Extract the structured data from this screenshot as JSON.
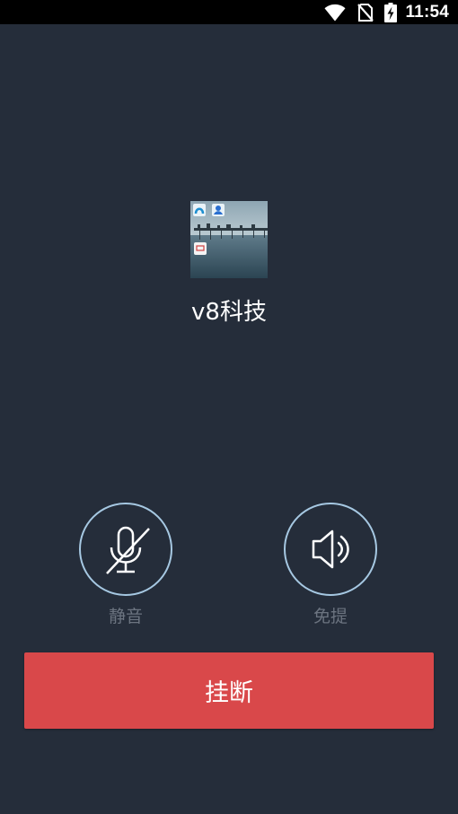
{
  "status_bar": {
    "time": "11:54",
    "icons": [
      "wifi-icon",
      "no-sim-icon",
      "battery-charging-icon"
    ]
  },
  "call": {
    "contact_name": "v8科技",
    "avatar": "pier-photo-avatar"
  },
  "controls": {
    "mute_label": "静音",
    "mute_icon": "microphone-off-icon",
    "speaker_label": "免提",
    "speaker_icon": "speaker-icon"
  },
  "hangup": {
    "label": "挂断"
  },
  "colors": {
    "background": "#252d3a",
    "ring": "#a6c8e2",
    "hangup": "#d9484a",
    "muted_label": "#6c7480"
  }
}
